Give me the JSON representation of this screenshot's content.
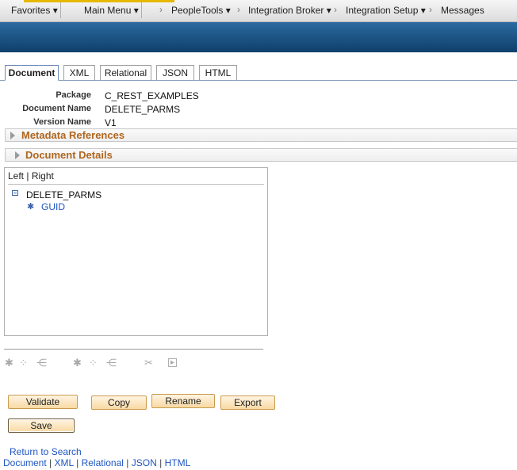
{
  "topnav": {
    "favorites": "Favorites",
    "main_menu": "Main Menu",
    "breadcrumbs": [
      "PeopleTools",
      "Integration Broker",
      "Integration Setup",
      "Messages"
    ],
    "dropdown_arrow": "▾",
    "chevron": "›"
  },
  "tabs": [
    "Document",
    "XML",
    "Relational",
    "JSON",
    "HTML"
  ],
  "fields": {
    "package_label": "Package",
    "package_value": "C_REST_EXAMPLES",
    "docname_label": "Document Name",
    "docname_value": "DELETE_PARMS",
    "version_label": "Version Name",
    "version_value": "V1"
  },
  "sections": {
    "metadata": "Metadata References",
    "details": "Document Details"
  },
  "tree": {
    "left": "Left",
    "divider": "|",
    "right": "Right",
    "root": "DELETE_PARMS",
    "child": "GUID"
  },
  "buttons": {
    "validate": "Validate",
    "copy": "Copy",
    "rename": "Rename",
    "export": "Export",
    "save": "Save"
  },
  "links": {
    "return_to_search": "Return to Search",
    "bottom": [
      "Document",
      "XML",
      "Relational",
      "JSON",
      "HTML"
    ],
    "pipe": "|"
  },
  "colors": {
    "banner": "#1b5287",
    "section_title": "#b0661f",
    "link": "#1f55c2",
    "button": "#f8d9a3"
  },
  "icons": [
    "dropdown-arrow-icon",
    "chevron-right-icon",
    "collapse-icon",
    "element-icon",
    "add-icon",
    "cut-icon",
    "insert-icon"
  ]
}
